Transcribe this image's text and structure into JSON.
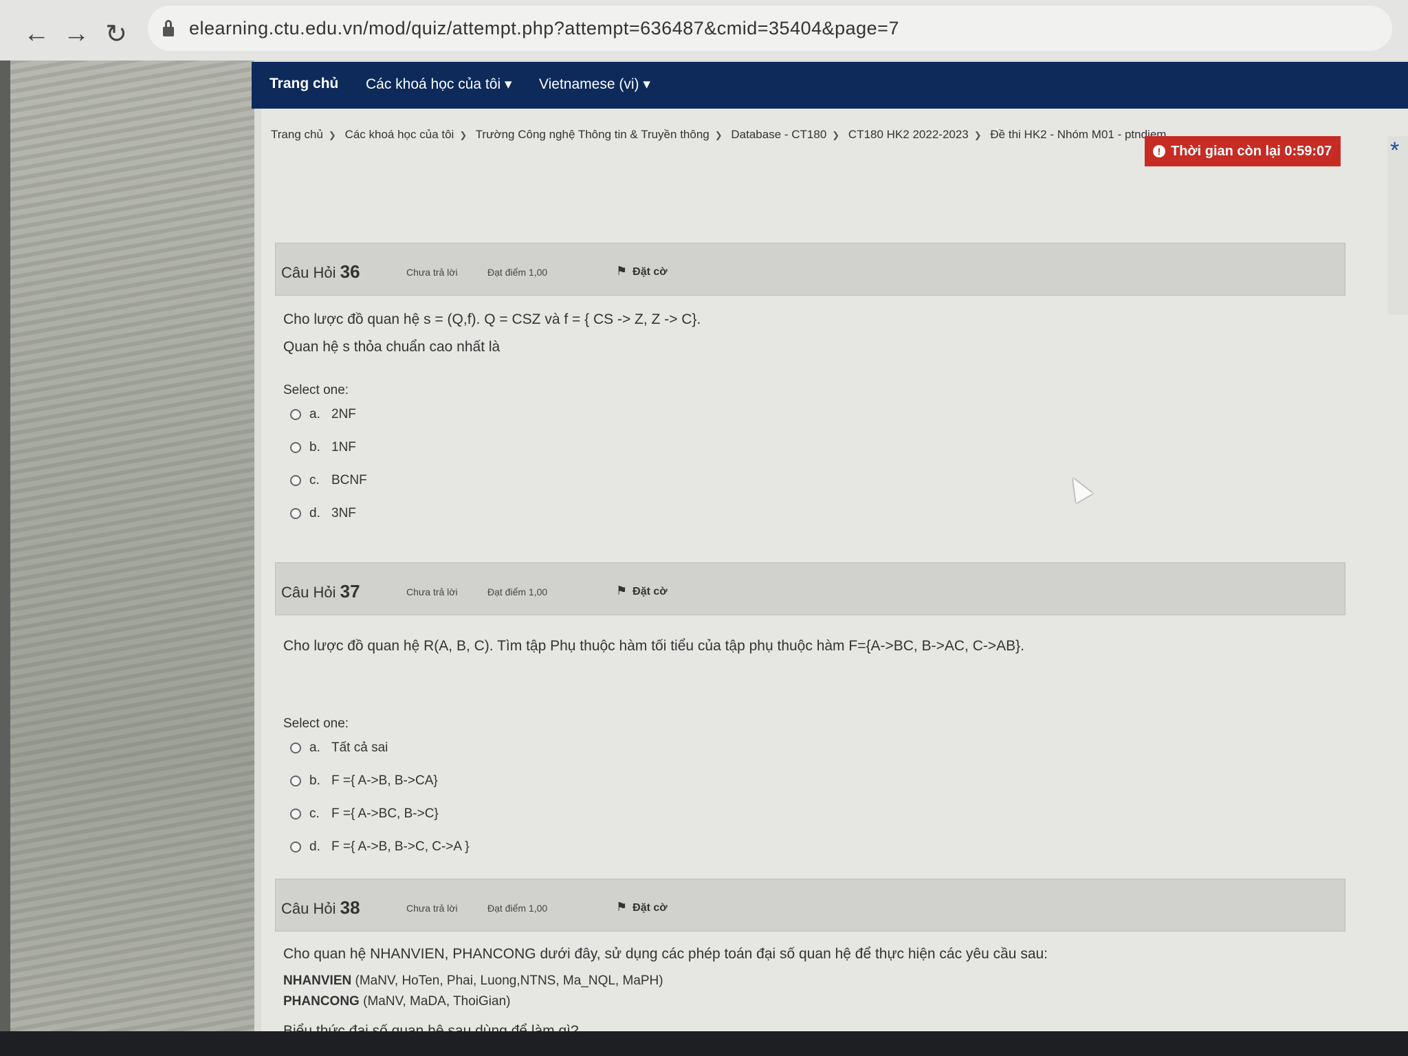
{
  "browser": {
    "url": "elearning.ctu.edu.vn/mod/quiz/attempt.php?attempt=636487&cmid=35404&page=7",
    "back_icon": "←",
    "forward_icon": "→",
    "reload_icon": "↻"
  },
  "topnav": {
    "home": "Trang chủ",
    "my_courses": "Các khoá học của tôi ▾",
    "language": "Vietnamese (vi) ▾"
  },
  "breadcrumb": [
    "Trang chủ",
    "Các khoá học của tôi",
    "Trường Công nghệ Thông tin & Truyền thông",
    "Database - CT180",
    "CT180 HK2 2022-2023",
    "Đề thi HK2 - Nhóm M01 - ptndiem"
  ],
  "timer": {
    "label": "Thời gian còn lại 0:59:07",
    "icon": "!"
  },
  "questions": [
    {
      "label": "Câu Hỏi",
      "number": "36",
      "status": "Chưa trả lời",
      "grade": "Đạt điểm 1,00",
      "flag": "Đặt cờ",
      "text": [
        "Cho lược đồ quan hệ s = (Q,f). Q = CSZ và f = { CS -> Z, Z -> C}.",
        "Quan hệ s thỏa chuẩn cao nhất là"
      ],
      "select_label": "Select one:",
      "options": [
        {
          "letter": "a.",
          "text": "2NF"
        },
        {
          "letter": "b.",
          "text": "1NF"
        },
        {
          "letter": "c.",
          "text": "BCNF"
        },
        {
          "letter": "d.",
          "text": "3NF"
        }
      ]
    },
    {
      "label": "Câu Hỏi",
      "number": "37",
      "status": "Chưa trả lời",
      "grade": "Đạt điểm 1,00",
      "flag": "Đặt cờ",
      "text": [
        "Cho lược đồ quan hệ R(A, B, C). Tìm tập Phụ thuộc hàm tối tiểu của tập phụ thuộc hàm F={A->BC, B->AC, C->AB}."
      ],
      "select_label": "Select one:",
      "options": [
        {
          "letter": "a.",
          "text": "Tất cả sai"
        },
        {
          "letter": "b.",
          "text": "F ={ A->B, B->CA}"
        },
        {
          "letter": "c.",
          "text": "F ={ A->BC, B->C}"
        },
        {
          "letter": "d.",
          "text": "F ={ A->B, B->C, C->A }"
        }
      ]
    },
    {
      "label": "Câu Hỏi",
      "number": "38",
      "status": "Chưa trả lời",
      "grade": "Đạt điểm 1,00",
      "flag": "Đặt cờ",
      "text": [
        "Cho quan hệ NHANVIEN, PHANCONG dưới đây, sử dụng các phép toán đại số quan hệ để thực hiện các yêu cầu sau:"
      ],
      "relations": [
        {
          "name": "NHANVIEN",
          "attrs": "(MaNV, HoTen, Phai, Luong,NTNS, Ma_NQL, MaPH)"
        },
        {
          "name": "PHANCONG",
          "attrs": "(MaNV, MaDA, ThoiGian)"
        }
      ],
      "footer_text": "Biểu thức đại số quan hệ sau dùng để làm gì?"
    }
  ]
}
